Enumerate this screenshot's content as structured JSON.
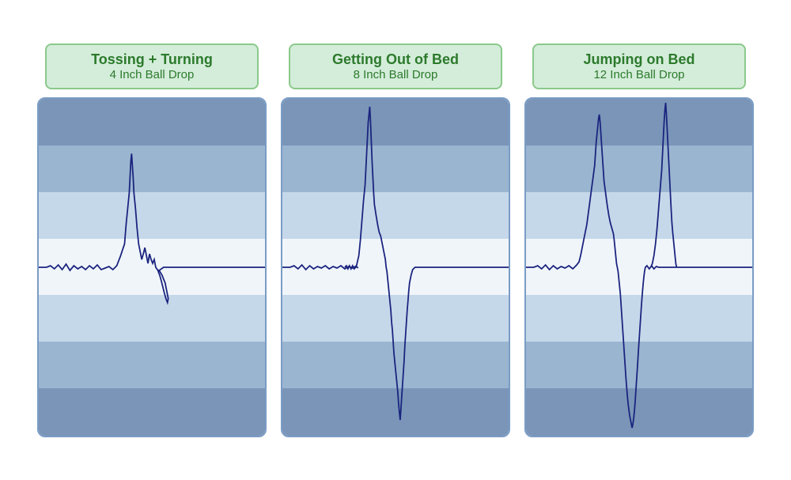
{
  "panels": [
    {
      "id": "panel1",
      "title": "Tossing + Turning",
      "subtitle": "4 Inch Ball Drop",
      "waveform": "small"
    },
    {
      "id": "panel2",
      "title": "Getting Out of Bed",
      "subtitle": "8 Inch Ball Drop",
      "waveform": "medium"
    },
    {
      "id": "panel3",
      "title": "Jumping on Bed",
      "subtitle": "12 Inch Ball Drop",
      "waveform": "large"
    }
  ]
}
